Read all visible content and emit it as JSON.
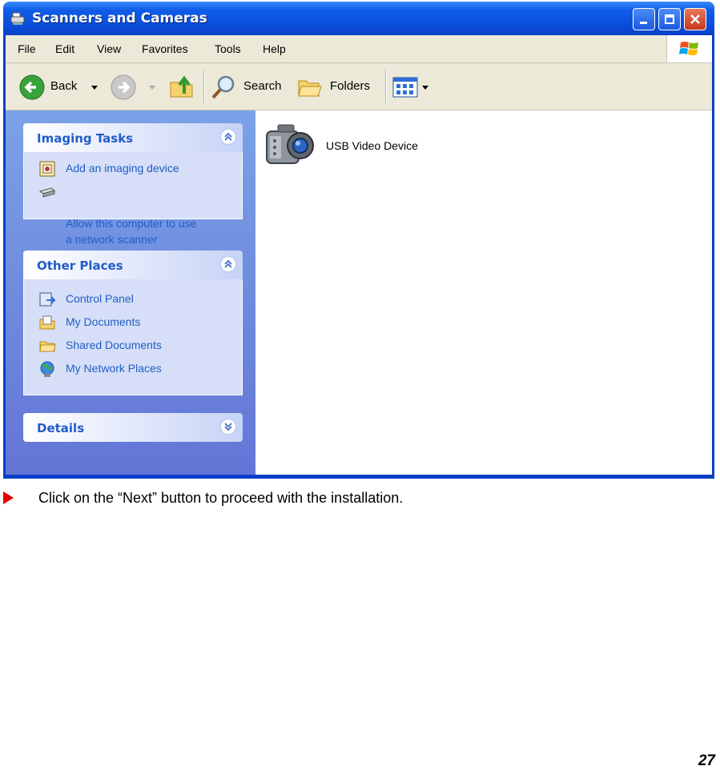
{
  "window": {
    "title": "Scanners and Cameras",
    "controls": {
      "minimize": "minimize-button",
      "maximize": "maximize-button",
      "close": "close-button"
    }
  },
  "menubar": {
    "items": [
      "File",
      "Edit",
      "View",
      "Favorites",
      "Tools",
      "Help"
    ]
  },
  "toolbar": {
    "back_label": "Back",
    "search_label": "Search",
    "folders_label": "Folders"
  },
  "sidepane": {
    "imaging_tasks": {
      "title": "Imaging Tasks",
      "items": [
        "Add an imaging device",
        "Allow this computer to use\na network scanner"
      ]
    },
    "other_places": {
      "title": "Other Places",
      "items": [
        "Control Panel",
        "My Documents",
        "Shared Documents",
        "My Network Places"
      ]
    },
    "details": {
      "title": "Details"
    }
  },
  "content": {
    "items": [
      {
        "label": "USB Video Device",
        "icon": "camcorder-icon"
      }
    ]
  },
  "document": {
    "caption": "Click on the “Next” button to proceed with the installation.",
    "page_number": "27"
  },
  "colors": {
    "title_bar": "#0a4ddb",
    "sidepane": "#6d8ce0",
    "link": "#215dc6",
    "bullet": "#e50000"
  }
}
